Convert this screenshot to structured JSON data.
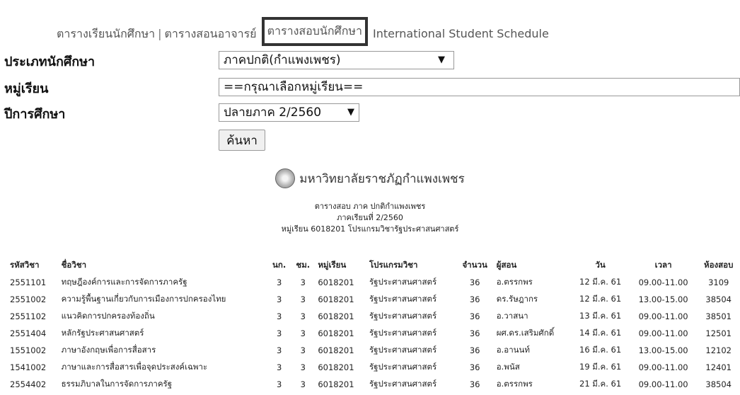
{
  "nav": {
    "items": [
      {
        "label": "ตารางเรียนนักศึกษา",
        "active": false
      },
      {
        "label": "ตารางสอนอาจารย์",
        "active": false
      },
      {
        "label": "ตารางสอบนักศึกษา",
        "active": true
      },
      {
        "label": "International Student Schedule",
        "active": false
      }
    ],
    "separator": "|"
  },
  "form": {
    "student_type": {
      "label": "ประเภทนักศึกษา",
      "value": "ภาคปกติ(กำแพงเพชร)"
    },
    "group": {
      "label": "หมู่เรียน",
      "value": "==กรุณาเลือกหมู่เรียน=="
    },
    "year": {
      "label": "ปีการศึกษา",
      "value": "ปลายภาค 2/2560"
    },
    "search_label": "ค้นหา",
    "dropdown_glyph": "▼"
  },
  "header": {
    "university": "มหาวิทยาลัยราชภัฏกำแพงเพชร",
    "line1": "ตารางสอบ ภาค ปกติกำแพงเพชร",
    "line2": "ภาคเรียนที่ 2/2560",
    "line3": "หมู่เรียน 6018201 โปรแกรมวิชารัฐประศาสนศาสตร์"
  },
  "table": {
    "columns": [
      "รหัสวิชา",
      "ชื่อวิชา",
      "นก.",
      "ชม.",
      "หมู่เรียน",
      "โปรแกรมวิชา",
      "จำนวน",
      "ผู้สอน",
      "วัน",
      "เวลา",
      "ห้องสอบ"
    ],
    "rows": [
      [
        "2551101",
        "ทฤษฎีองค์การและการจัดการภาครัฐ",
        "3",
        "3",
        "6018201",
        "รัฐประศาสนศาสตร์",
        "36",
        "อ.ตรรกพร",
        "12 มี.ค. 61",
        "09.00-11.00",
        "3109"
      ],
      [
        "2551002",
        "ความรู้พื้นฐานเกี่ยวกับการเมืองการปกครองไทย",
        "3",
        "3",
        "6018201",
        "รัฐประศาสนศาสตร์",
        "36",
        "ดร.รัษฎากร",
        "12 มี.ค. 61",
        "13.00-15.00",
        "38504"
      ],
      [
        "2551102",
        "แนวคิดการปกครองท้องถิ่น",
        "3",
        "3",
        "6018201",
        "รัฐประศาสนศาสตร์",
        "36",
        "อ.วาสนา",
        "13 มี.ค. 61",
        "09.00-11.00",
        "38501"
      ],
      [
        "2551404",
        "หลักรัฐประศาสนศาสตร์",
        "3",
        "3",
        "6018201",
        "รัฐประศาสนศาสตร์",
        "36",
        "ผศ.ดร.เสริมศักดิ์",
        "14 มี.ค. 61",
        "09.00-11.00",
        "12501"
      ],
      [
        "1551002",
        "ภาษาอังกฤษเพื่อการสื่อสาร",
        "3",
        "3",
        "6018201",
        "รัฐประศาสนศาสตร์",
        "36",
        "อ.อานนท์",
        "16 มี.ค. 61",
        "13.00-15.00",
        "12102"
      ],
      [
        "1541002",
        "ภาษาและการสื่อสารเพื่อจุดประสงค์เฉพาะ",
        "3",
        "3",
        "6018201",
        "รัฐประศาสนศาสตร์",
        "36",
        "อ.พนัส",
        "19 มี.ค. 61",
        "09.00-11.00",
        "12401"
      ],
      [
        "2554402",
        "ธรรมภิบาลในการจัดการภาครัฐ",
        "3",
        "3",
        "6018201",
        "รัฐประศาสนศาสตร์",
        "36",
        "อ.ตรรกพร",
        "21 มี.ค. 61",
        "09.00-11.00",
        "38504"
      ]
    ]
  }
}
